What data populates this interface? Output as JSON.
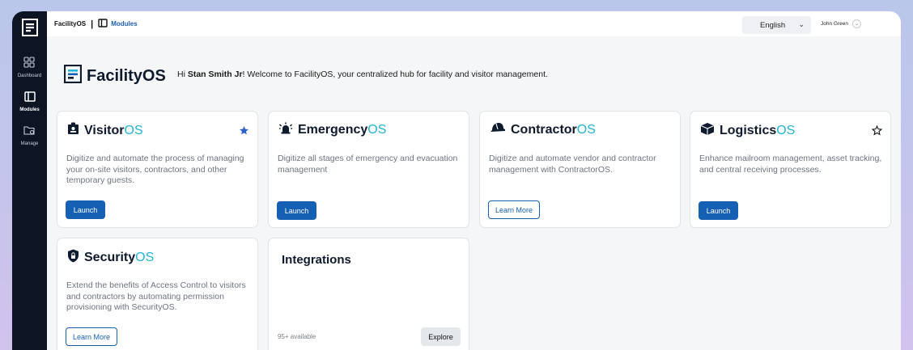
{
  "topbar": {
    "app_name": "FacilityOS",
    "separator": "|",
    "current_module": "Modules",
    "language": "English",
    "user_name": "John Green"
  },
  "sidebar": {
    "items": [
      {
        "label": "Dashboard",
        "icon": "grid-icon"
      },
      {
        "label": "Modules",
        "icon": "layout-panel-icon"
      },
      {
        "label": "Manage",
        "icon": "folder-gear-icon"
      }
    ],
    "active": "Modules"
  },
  "hero": {
    "title": "FacilityOS",
    "welcome_prefix": "Hi ",
    "welcome_name": "Stan Smith Jr",
    "welcome_suffix": "! Welcome to FacilityOS, your centralized hub for facility and visitor management."
  },
  "cards": [
    {
      "title": "Visitor",
      "title_os": "OS",
      "desc": "Digitize and automate the process of managing your on-site visitors, contractors, and other temporary guests.",
      "button": "Launch",
      "icon": "badge-icon",
      "starred": true
    },
    {
      "title": "Emergency",
      "title_os": "OS",
      "desc": "Digitize all stages of emergency and evacuation management",
      "button": "Launch",
      "icon": "alarm-icon"
    },
    {
      "title": "Contractor",
      "title_os": "OS",
      "desc": "Digitize and automate vendor and contractor management with ContractorOS.",
      "button": "Learn More",
      "icon": "hard-hat-icon"
    },
    {
      "title": "Logistics",
      "title_os": "OS",
      "desc": "Enhance mailroom management, asset tracking, and central receiving processes.",
      "button": "Launch",
      "icon": "package-icon",
      "starred": false
    },
    {
      "title": "Security",
      "title_os": "OS",
      "desc": "Extend the benefits of Access Control to visitors and contractors by automating permission provisioning with SecurityOS.",
      "button": "Learn More",
      "icon": "shield-lock-icon"
    }
  ],
  "integrations": {
    "title": "Integrations",
    "available": "95+ available",
    "button": "Explore"
  },
  "colors": {
    "primary": "#1560b3",
    "accent_os": "#22b5d6",
    "sidebar_bg": "#0d1525"
  }
}
